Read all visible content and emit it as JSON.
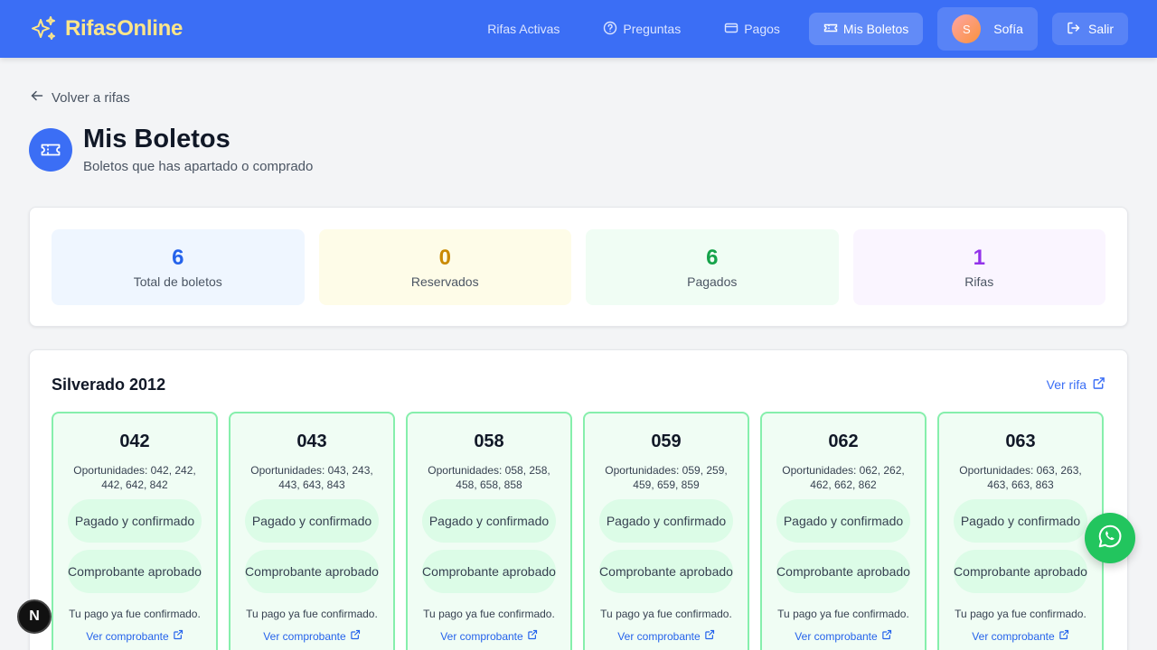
{
  "brand": {
    "name": "RifasOnline"
  },
  "nav": {
    "items": [
      {
        "label": "Rifas Activas",
        "icon": "none"
      },
      {
        "label": "Preguntas",
        "icon": "question-circle-icon"
      },
      {
        "label": "Pagos",
        "icon": "credit-card-icon"
      },
      {
        "label": "Mis Boletos",
        "icon": "ticket-icon",
        "active": true
      }
    ],
    "user": {
      "initial": "S",
      "name": "Sofía"
    },
    "logout_label": "Salir"
  },
  "back_label": "Volver a rifas",
  "header": {
    "title": "Mis Boletos",
    "subtitle": "Boletos que has apartado o comprado"
  },
  "stats": [
    {
      "value": "6",
      "label": "Total de boletos",
      "color": "#2563eb",
      "bg": "#eff6ff"
    },
    {
      "value": "0",
      "label": "Reservados",
      "color": "#ca8a04",
      "bg": "#fefce8"
    },
    {
      "value": "6",
      "label": "Pagados",
      "color": "#16a34a",
      "bg": "#f0fdf4"
    },
    {
      "value": "1",
      "label": "Rifas",
      "color": "#9333ea",
      "bg": "#faf5ff"
    }
  ],
  "raffle": {
    "name": "Silverado 2012",
    "link_label": "Ver rifa",
    "tickets": [
      {
        "number": "042",
        "opportunities": "Oportunidades: 042, 242, 442, 642, 842",
        "status": "Pagado y confirmado",
        "receipt": "Comprobante aprobado",
        "note": "Tu pago ya fue confirmado.",
        "link": "Ver comprobante"
      },
      {
        "number": "043",
        "opportunities": "Oportunidades: 043, 243, 443, 643, 843",
        "status": "Pagado y confirmado",
        "receipt": "Comprobante aprobado",
        "note": "Tu pago ya fue confirmado.",
        "link": "Ver comprobante"
      },
      {
        "number": "058",
        "opportunities": "Oportunidades: 058, 258, 458, 658, 858",
        "status": "Pagado y confirmado",
        "receipt": "Comprobante aprobado",
        "note": "Tu pago ya fue confirmado.",
        "link": "Ver comprobante"
      },
      {
        "number": "059",
        "opportunities": "Oportunidades: 059, 259, 459, 659, 859",
        "status": "Pagado y confirmado",
        "receipt": "Comprobante aprobado",
        "note": "Tu pago ya fue confirmado.",
        "link": "Ver comprobante"
      },
      {
        "number": "062",
        "opportunities": "Oportunidades: 062, 262, 462, 662, 862",
        "status": "Pagado y confirmado",
        "receipt": "Comprobante aprobado",
        "note": "Tu pago ya fue confirmado.",
        "link": "Ver comprobante"
      },
      {
        "number": "063",
        "opportunities": "Oportunidades: 063, 263, 463, 663, 863",
        "status": "Pagado y confirmado",
        "receipt": "Comprobante aprobado",
        "note": "Tu pago ya fue confirmado.",
        "link": "Ver comprobante"
      }
    ]
  },
  "floating": {
    "whatsapp_icon": "whatsapp-icon",
    "dev_badge": "N"
  }
}
